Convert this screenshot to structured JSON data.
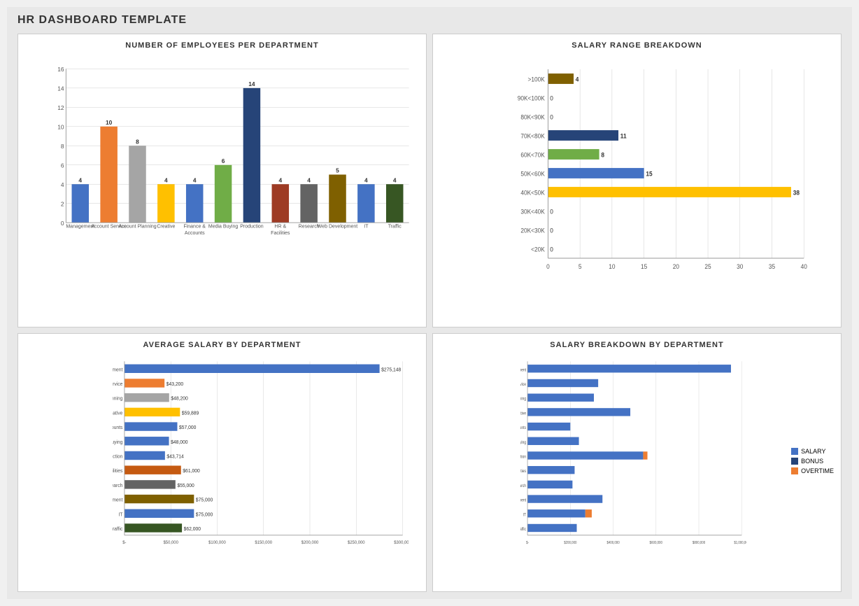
{
  "page": {
    "title": "HR DASHBOARD TEMPLATE"
  },
  "charts": {
    "employees_per_dept": {
      "title": "NUMBER OF EMPLOYEES PER DEPARTMENT",
      "departments": [
        {
          "name": "Management",
          "value": 4,
          "color": "#4472C4"
        },
        {
          "name": "Account Service",
          "value": 10,
          "color": "#ED7D31"
        },
        {
          "name": "Account Planning",
          "value": 8,
          "color": "#A5A5A5"
        },
        {
          "name": "Creative",
          "value": 4,
          "color": "#FFC000"
        },
        {
          "name": "Finance & Accounts",
          "value": 4,
          "color": "#4472C4"
        },
        {
          "name": "Media Buying",
          "value": 6,
          "color": "#70AD47"
        },
        {
          "name": "Production",
          "value": 14,
          "color": "#264478"
        },
        {
          "name": "HR & Facilities",
          "value": 4,
          "color": "#9E3B24"
        },
        {
          "name": "Research",
          "value": 4,
          "color": "#636363"
        },
        {
          "name": "Web Development",
          "value": 5,
          "color": "#7F6000"
        },
        {
          "name": "IT",
          "value": 4,
          "color": "#4472C4"
        },
        {
          "name": "Traffic",
          "value": 4,
          "color": "#375623"
        }
      ],
      "y_max": 16,
      "y_ticks": [
        0,
        2,
        4,
        6,
        8,
        10,
        12,
        14,
        16
      ]
    },
    "salary_range": {
      "title": "SALARY RANGE BREAKDOWN",
      "ranges": [
        {
          "label": ">100K",
          "value": 4,
          "color": "#7F6000"
        },
        {
          "label": "90K<100K",
          "value": 0,
          "color": "#4472C4"
        },
        {
          "label": "80K<90K",
          "value": 0,
          "color": "#4472C4"
        },
        {
          "label": "70K<80K",
          "value": 11,
          "color": "#264478"
        },
        {
          "label": "60K<70K",
          "value": 8,
          "color": "#70AD47"
        },
        {
          "label": "50K<60K",
          "value": 15,
          "color": "#4472C4"
        },
        {
          "label": "40K<50K",
          "value": 38,
          "color": "#FFC000"
        },
        {
          "label": "30K<40K",
          "value": 0,
          "color": "#4472C4"
        },
        {
          "label": "20K<30K",
          "value": 0,
          "color": "#4472C4"
        },
        {
          "label": "<20K",
          "value": 0,
          "color": "#4472C4"
        }
      ],
      "x_max": 40,
      "x_ticks": [
        0,
        5,
        10,
        15,
        20,
        25,
        30,
        35,
        40
      ]
    },
    "avg_salary": {
      "title": "AVERAGE SALARY BY DEPARTMENT",
      "departments": [
        {
          "name": "Management",
          "value": 275148,
          "color": "#4472C4"
        },
        {
          "name": "Account Service",
          "value": 43200,
          "color": "#ED7D31"
        },
        {
          "name": "Account Planning",
          "value": 48200,
          "color": "#A5A5A5"
        },
        {
          "name": "Creative",
          "value": 59889,
          "color": "#FFC000"
        },
        {
          "name": "Finance & Accounts",
          "value": 57000,
          "color": "#4472C4"
        },
        {
          "name": "Media Buying",
          "value": 48000,
          "color": "#4472C4"
        },
        {
          "name": "Production",
          "value": 43714,
          "color": "#4472C4"
        },
        {
          "name": "HR & Facilities",
          "value": 61000,
          "color": "#C55A11"
        },
        {
          "name": "Research",
          "value": 55000,
          "color": "#636363"
        },
        {
          "name": "Web Development",
          "value": 75000,
          "color": "#7F6000"
        },
        {
          "name": "IT",
          "value": 75000,
          "color": "#4472C4"
        },
        {
          "name": "Traffic",
          "value": 62000,
          "color": "#375623"
        }
      ],
      "x_max": 300000,
      "x_ticks": [
        "$-",
        "$50,000",
        "$100,000",
        "$150,000",
        "$200,000",
        "$250,000",
        "$300,000"
      ],
      "labels": [
        "$275,148",
        "$43,200",
        "$48,200",
        "$59,889",
        "$57,000",
        "$48,000",
        "$43,714",
        "$61,000",
        "$55,000",
        "$75,000",
        "$75,000",
        "$62,000"
      ]
    },
    "salary_breakdown": {
      "title": "SALARY BREAKDOWN BY DEPARTMENT",
      "departments": [
        {
          "name": "Management",
          "salary": 950,
          "bonus": 0,
          "overtime": 0
        },
        {
          "name": "Account Service",
          "salary": 330,
          "bonus": 0,
          "overtime": 0
        },
        {
          "name": "Account Planning",
          "salary": 310,
          "bonus": 0,
          "overtime": 0
        },
        {
          "name": "Creative",
          "salary": 480,
          "bonus": 0,
          "overtime": 0
        },
        {
          "name": "Finance & Accounts",
          "salary": 200,
          "bonus": 0,
          "overtime": 0
        },
        {
          "name": "Media Buying",
          "salary": 240,
          "bonus": 0,
          "overtime": 0
        },
        {
          "name": "Production",
          "salary": 540,
          "bonus": 20,
          "overtime": 0
        },
        {
          "name": "HR & Facilities",
          "salary": 220,
          "bonus": 0,
          "overtime": 0
        },
        {
          "name": "Research",
          "salary": 210,
          "bonus": 0,
          "overtime": 0
        },
        {
          "name": "Web Development",
          "salary": 350,
          "bonus": 0,
          "overtime": 0
        },
        {
          "name": "IT",
          "salary": 270,
          "bonus": 30,
          "overtime": 0
        },
        {
          "name": "Traffic",
          "salary": 230,
          "bonus": 0,
          "overtime": 0
        }
      ],
      "x_ticks": [
        "$-",
        "$200,000",
        "$400,000",
        "$600,000",
        "$800,000",
        "$1,000,000",
        "$1,200,000"
      ],
      "legend": {
        "salary_label": "SALARY",
        "bonus_label": "BONUS",
        "overtime_label": "OVERTIME",
        "salary_color": "#4472C4",
        "bonus_color": "#264478",
        "overtime_color": "#ED7D31"
      }
    }
  }
}
